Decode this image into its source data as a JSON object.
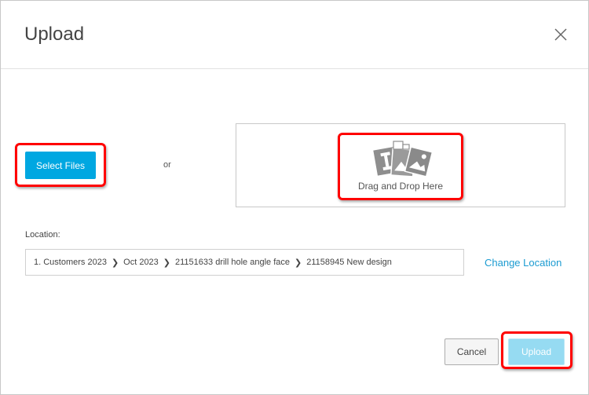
{
  "dialog": {
    "title": "Upload",
    "close_icon": "close-icon"
  },
  "select_files": {
    "label": "Select Files",
    "color": "#00a7e1"
  },
  "or_text": "or",
  "dropzone": {
    "icon": "drag-drop-images-icon",
    "label": "Drag and Drop Here"
  },
  "location": {
    "label": "Location:",
    "breadcrumbs": [
      "1. Customers 2023",
      "Oct 2023",
      "21151633 drill hole angle face",
      "21158945 New design"
    ],
    "separator_icon": "chevron-right-icon",
    "change_label": "Change Location",
    "link_color": "#1b9bd1"
  },
  "footer": {
    "cancel_label": "Cancel",
    "upload_label": "Upload",
    "upload_color": "#96dbf2"
  },
  "annotations": {
    "highlight_color": "#ff0000"
  }
}
